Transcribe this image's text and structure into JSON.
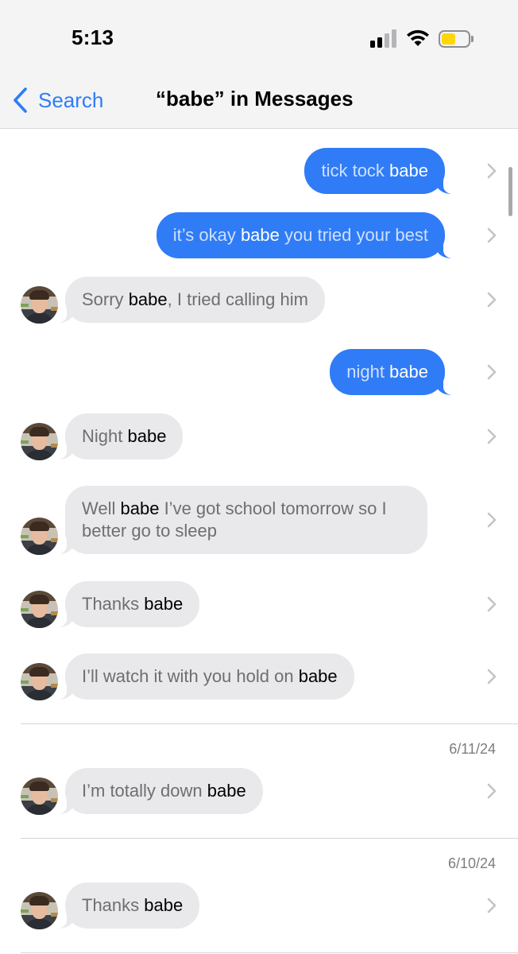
{
  "status_bar": {
    "time": "5:13",
    "icons": [
      "cellular-signal-icon",
      "wifi-icon",
      "battery-low-power-icon"
    ],
    "battery_color": "#ffd60a"
  },
  "nav": {
    "back_label": "Search",
    "title": "“babe” in Messages"
  },
  "colors": {
    "accent": "#2f7cf6",
    "outgoing_bubble": "#2f7cf6",
    "incoming_bubble": "#e9e9eb"
  },
  "messages": [
    {
      "direction": "outgoing",
      "parts": [
        {
          "t": "tick tock ",
          "hl": false
        },
        {
          "t": "babe",
          "hl": true
        }
      ]
    },
    {
      "direction": "outgoing",
      "parts": [
        {
          "t": "it’s okay ",
          "hl": false
        },
        {
          "t": "babe",
          "hl": true
        },
        {
          "t": " you tried your best",
          "hl": false
        }
      ]
    },
    {
      "direction": "incoming",
      "parts": [
        {
          "t": "Sorry ",
          "hl": false
        },
        {
          "t": "babe",
          "hl": true
        },
        {
          "t": ", I tried calling him",
          "hl": false
        }
      ]
    },
    {
      "direction": "outgoing",
      "parts": [
        {
          "t": "night ",
          "hl": false
        },
        {
          "t": "babe",
          "hl": true
        }
      ]
    },
    {
      "direction": "incoming",
      "parts": [
        {
          "t": "Night ",
          "hl": false
        },
        {
          "t": "babe",
          "hl": true
        }
      ]
    },
    {
      "direction": "incoming",
      "parts": [
        {
          "t": "Well ",
          "hl": false
        },
        {
          "t": "babe",
          "hl": true
        },
        {
          "t": " I’ve got school tomorrow so I better go to sleep",
          "hl": false
        }
      ]
    },
    {
      "direction": "incoming",
      "parts": [
        {
          "t": "Thanks ",
          "hl": false
        },
        {
          "t": "babe",
          "hl": true
        }
      ]
    },
    {
      "direction": "incoming",
      "parts": [
        {
          "t": "I’ll watch it with you hold on ",
          "hl": false
        },
        {
          "t": "babe",
          "hl": true
        }
      ]
    },
    {
      "direction": "incoming",
      "date": "6/11/24",
      "parts": [
        {
          "t": "I’m totally down ",
          "hl": false
        },
        {
          "t": "babe",
          "hl": true
        }
      ]
    },
    {
      "direction": "incoming",
      "date": "6/10/24",
      "parts": [
        {
          "t": "Thanks ",
          "hl": false
        },
        {
          "t": "babe",
          "hl": true
        }
      ]
    }
  ]
}
